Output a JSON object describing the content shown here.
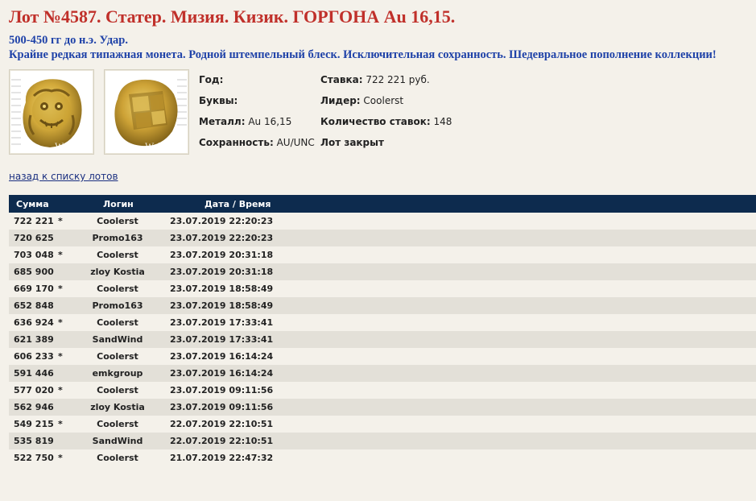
{
  "lot": {
    "title": "Лот №4587.  Статер. Мизия. Кизик. ГОРГОНА Au 16,15.",
    "subtitle1": "500-450 гг до н.э. Удар.",
    "subtitle2": "Крайне редкая типажная монета. Родной штемпельный блеск. Исключительная сохранность. Шедевральное пополнение коллекции!"
  },
  "images": {
    "obverse_watermark": "Wolmar",
    "reverse_watermark": "Wolmar"
  },
  "details": {
    "year_label": "Год:",
    "year_value": "",
    "letters_label": "Буквы:",
    "letters_value": "",
    "metal_label": "Металл:",
    "metal_value": "Au 16,15",
    "condition_label": "Сохранность:",
    "condition_value": "AU/UNC",
    "bid_label": "Ставка:",
    "bid_value": "722 221 руб.",
    "leader_label": "Лидер:",
    "leader_value": "Coolerst",
    "count_label": "Количество ставок:",
    "count_value": "148",
    "status": "Лот закрыт"
  },
  "back_link": "назад к списку лотов",
  "bids_table": {
    "headers": {
      "sum": "Сумма",
      "login": "Логин",
      "datetime": "Дата / Время"
    },
    "rows": [
      {
        "sum": "722 221",
        "star": "*",
        "login": "Coolerst",
        "datetime": "23.07.2019 22:20:23"
      },
      {
        "sum": "720 625",
        "star": "",
        "login": "Promo163",
        "datetime": "23.07.2019 22:20:23"
      },
      {
        "sum": "703 048",
        "star": "*",
        "login": "Coolerst",
        "datetime": "23.07.2019 20:31:18"
      },
      {
        "sum": "685 900",
        "star": "",
        "login": "zloy Kostia",
        "datetime": "23.07.2019 20:31:18"
      },
      {
        "sum": "669 170",
        "star": "*",
        "login": "Coolerst",
        "datetime": "23.07.2019 18:58:49"
      },
      {
        "sum": "652 848",
        "star": "",
        "login": "Promo163",
        "datetime": "23.07.2019 18:58:49"
      },
      {
        "sum": "636 924",
        "star": "*",
        "login": "Coolerst",
        "datetime": "23.07.2019 17:33:41"
      },
      {
        "sum": "621 389",
        "star": "",
        "login": "SandWind",
        "datetime": "23.07.2019 17:33:41"
      },
      {
        "sum": "606 233",
        "star": "*",
        "login": "Coolerst",
        "datetime": "23.07.2019 16:14:24"
      },
      {
        "sum": "591 446",
        "star": "",
        "login": "emkgroup",
        "datetime": "23.07.2019 16:14:24"
      },
      {
        "sum": "577 020",
        "star": "*",
        "login": "Coolerst",
        "datetime": "23.07.2019 09:11:56"
      },
      {
        "sum": "562 946",
        "star": "",
        "login": "zloy Kostia",
        "datetime": "23.07.2019 09:11:56"
      },
      {
        "sum": "549 215",
        "star": "*",
        "login": "Coolerst",
        "datetime": "22.07.2019 22:10:51"
      },
      {
        "sum": "535 819",
        "star": "",
        "login": "SandWind",
        "datetime": "22.07.2019 22:10:51"
      },
      {
        "sum": "522 750",
        "star": "*",
        "login": "Coolerst",
        "datetime": "21.07.2019 22:47:32"
      }
    ]
  }
}
